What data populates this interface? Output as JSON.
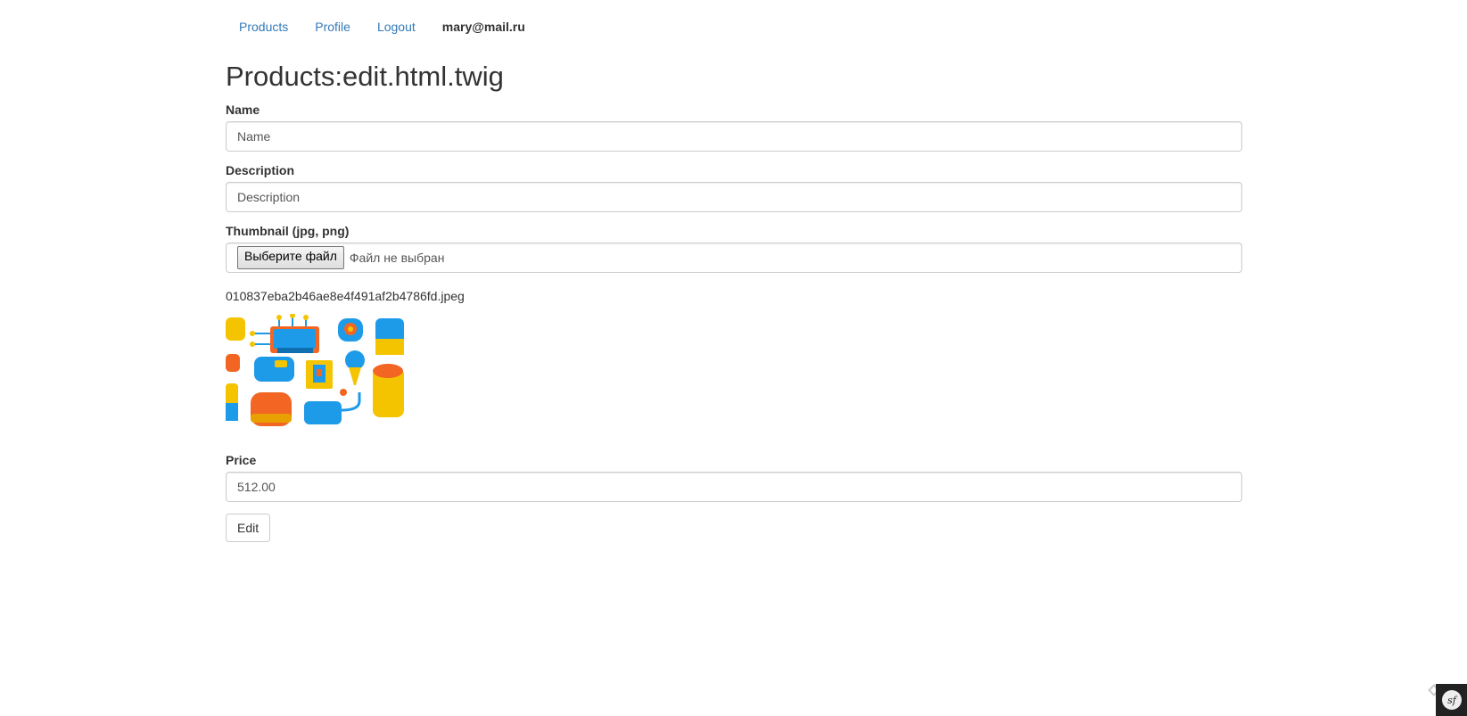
{
  "nav": {
    "links": [
      "Products",
      "Profile",
      "Logout"
    ],
    "user_email": "mary@mail.ru"
  },
  "page_title": "Products:edit.html.twig",
  "form": {
    "name": {
      "label": "Name",
      "placeholder": "Name",
      "value": ""
    },
    "description": {
      "label": "Description",
      "placeholder": "Description",
      "value": ""
    },
    "thumbnail": {
      "label": "Thumbnail (jpg, png)",
      "choose_button": "Выберите файл",
      "status": "Файл не выбран",
      "current_file": "010837eba2b46ae8e4f491af2b4786fd.jpeg"
    },
    "price": {
      "label": "Price",
      "value": "512.00"
    },
    "submit_label": "Edit"
  },
  "toolbar": {
    "icon": "symfony-icon"
  },
  "colors": {
    "link": "#337ab7",
    "text": "#333333",
    "border": "#cccccc"
  }
}
